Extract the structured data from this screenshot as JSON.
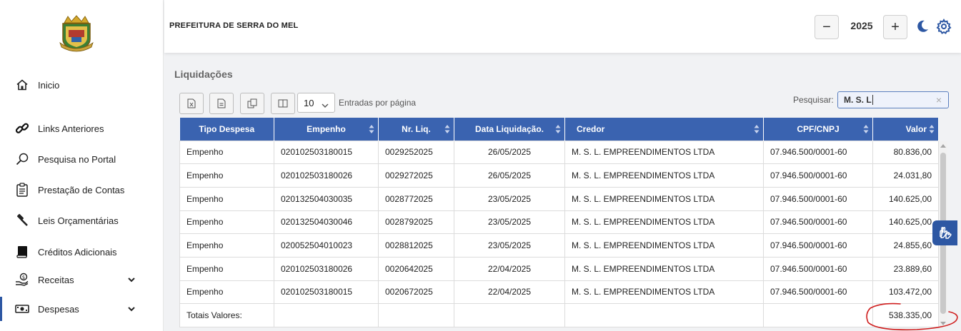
{
  "header": {
    "org_title": "PREFEITURA DE SERRA DO MEL",
    "year": "2025",
    "decrement_label": "−",
    "increment_label": "+"
  },
  "sidebar": {
    "items": [
      {
        "label": "Inicio",
        "icon": "home-icon"
      },
      {
        "label": "Links Anteriores",
        "icon": "link-icon"
      },
      {
        "label": "Pesquisa no Portal",
        "icon": "search-icon"
      },
      {
        "label": "Prestação de Contas",
        "icon": "clipboard-icon"
      },
      {
        "label": "Leis Orçamentárias",
        "icon": "gavel-icon"
      },
      {
        "label": "Créditos Adicionais",
        "icon": "book-icon"
      },
      {
        "label": "Receitas",
        "icon": "money-hand-icon"
      },
      {
        "label": "Despesas",
        "icon": "cash-icon"
      }
    ]
  },
  "main": {
    "section_title": "Liquidações",
    "page_length": "10",
    "page_length_label": "Entradas por página",
    "search_label": "Pesquisar:",
    "search_value": "M. S. L",
    "clear_label": "×"
  },
  "table": {
    "columns": [
      "Tipo Despesa",
      "Empenho",
      "Nr. Liq.",
      "Data Liquidação.",
      "Credor",
      "CPF/CNPJ",
      "Valor"
    ],
    "rows": [
      [
        "Empenho",
        "020102503180015",
        "0029252025",
        "26/05/2025",
        "M. S. L. EMPREENDIMENTOS LTDA",
        "07.946.500/0001-60",
        "80.836,00"
      ],
      [
        "Empenho",
        "020102503180026",
        "0029272025",
        "26/05/2025",
        "M. S. L. EMPREENDIMENTOS LTDA",
        "07.946.500/0001-60",
        "24.031,80"
      ],
      [
        "Empenho",
        "020132504030035",
        "0028772025",
        "23/05/2025",
        "M. S. L. EMPREENDIMENTOS LTDA",
        "07.946.500/0001-60",
        "140.625,00"
      ],
      [
        "Empenho",
        "020132504030046",
        "0028792025",
        "23/05/2025",
        "M. S. L. EMPREENDIMENTOS LTDA",
        "07.946.500/0001-60",
        "140.625,00"
      ],
      [
        "Empenho",
        "020052504010023",
        "0028812025",
        "23/05/2025",
        "M. S. L. EMPREENDIMENTOS LTDA",
        "07.946.500/0001-60",
        "24.855,60"
      ],
      [
        "Empenho",
        "020102503180026",
        "0020642025",
        "22/04/2025",
        "M. S. L. EMPREENDIMENTOS LTDA",
        "07.946.500/0001-60",
        "23.889,60"
      ],
      [
        "Empenho",
        "020102503180015",
        "0020672025",
        "22/04/2025",
        "M. S. L. EMPREENDIMENTOS LTDA",
        "07.946.500/0001-60",
        "103.472,00"
      ]
    ],
    "totals_label": "Totais Valores:",
    "totals_value": "538.335,00"
  },
  "colors": {
    "header_blue": "#3a63b0",
    "accent_blue": "#2d57a3",
    "annotation_red": "#d01f1f"
  }
}
